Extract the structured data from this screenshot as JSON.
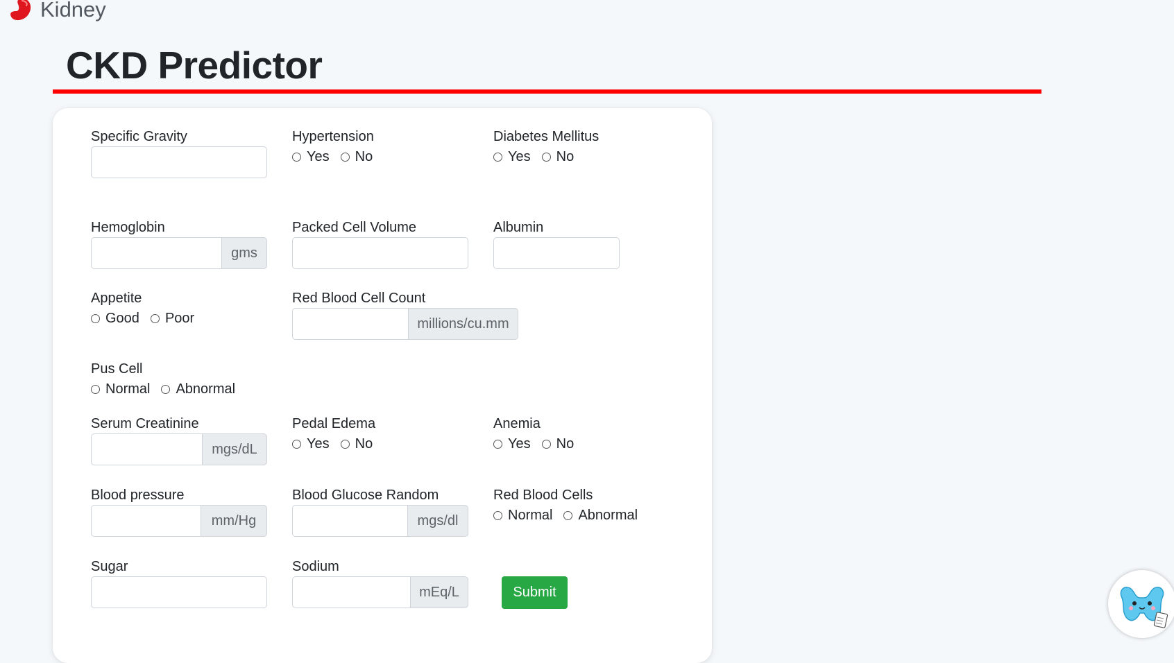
{
  "brand": {
    "name": "Kidney",
    "icon": "kidney-logo-icon"
  },
  "page_title": "CKD Predictor",
  "colors": {
    "accent_red": "#ff0000",
    "submit_green": "#28a745",
    "addon_bg": "#e9ecef"
  },
  "fields": {
    "specific_gravity": {
      "label": "Specific Gravity",
      "value": ""
    },
    "hypertension": {
      "label": "Hypertension",
      "options": [
        "Yes",
        "No"
      ]
    },
    "diabetes_mellitus": {
      "label": "Diabetes Mellitus",
      "options": [
        "Yes",
        "No"
      ]
    },
    "hemoglobin": {
      "label": "Hemoglobin",
      "value": "",
      "unit": "gms"
    },
    "packed_cell_volume": {
      "label": "Packed Cell Volume",
      "value": ""
    },
    "albumin": {
      "label": "Albumin",
      "value": ""
    },
    "appetite": {
      "label": "Appetite",
      "options": [
        "Good",
        "Poor"
      ]
    },
    "red_blood_cell_count": {
      "label": "Red Blood Cell Count",
      "value": "",
      "unit": "millions/cu.mm"
    },
    "pus_cell": {
      "label": "Pus Cell",
      "options": [
        "Normal",
        "Abnormal"
      ]
    },
    "serum_creatinine": {
      "label": "Serum Creatinine",
      "value": "",
      "unit": "mgs/dL"
    },
    "pedal_edema": {
      "label": "Pedal Edema",
      "options": [
        "Yes",
        "No"
      ]
    },
    "anemia": {
      "label": "Anemia",
      "options": [
        "Yes",
        "No"
      ]
    },
    "blood_pressure": {
      "label": "Blood pressure",
      "value": "",
      "unit": "mm/Hg"
    },
    "blood_glucose_random": {
      "label": "Blood Glucose Random",
      "value": "",
      "unit": "mgs/dl"
    },
    "red_blood_cells": {
      "label": "Red Blood Cells",
      "options": [
        "Normal",
        "Abnormal"
      ]
    },
    "sugar": {
      "label": "Sugar",
      "value": ""
    },
    "sodium": {
      "label": "Sodium",
      "value": "",
      "unit": "mEq/L"
    }
  },
  "submit_label": "Submit",
  "mascot": {
    "icon": "kidney-mascot-icon"
  }
}
